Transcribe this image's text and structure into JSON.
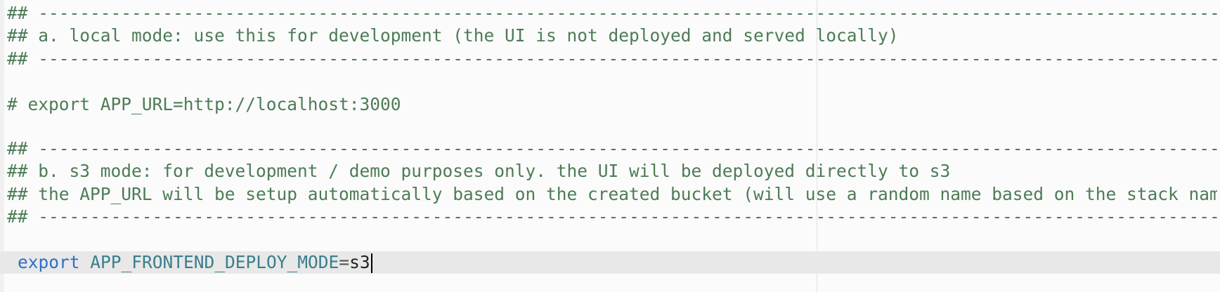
{
  "editor": {
    "lines": {
      "sep_1": "## -------------------------------------------------------------------------------------------------------------------------",
      "local_mode_heading": "## a. local mode: use this for development (the UI is not deployed and served locally)",
      "sep_2": "## -------------------------------------------------------------------------------------------------------------------------",
      "export_app_url_commented": "# export APP_URL=http://localhost:3000",
      "sep_3": "## -------------------------------------------------------------------------------------------------------------------------",
      "s3_mode_heading": "## b. s3 mode: for development / demo purposes only. the UI will be deployed directly to s3",
      "s3_mode_note": "## the APP_URL will be setup automatically based on the created bucket (will use a random name based on the stack name)",
      "sep_4": "## -------------------------------------------------------------------------------------------------------------------------"
    },
    "active_line": {
      "keyword": "export",
      "variable": "APP_FRONTEND_DEPLOY_MODE",
      "operator": "=",
      "value": "s3"
    }
  }
}
